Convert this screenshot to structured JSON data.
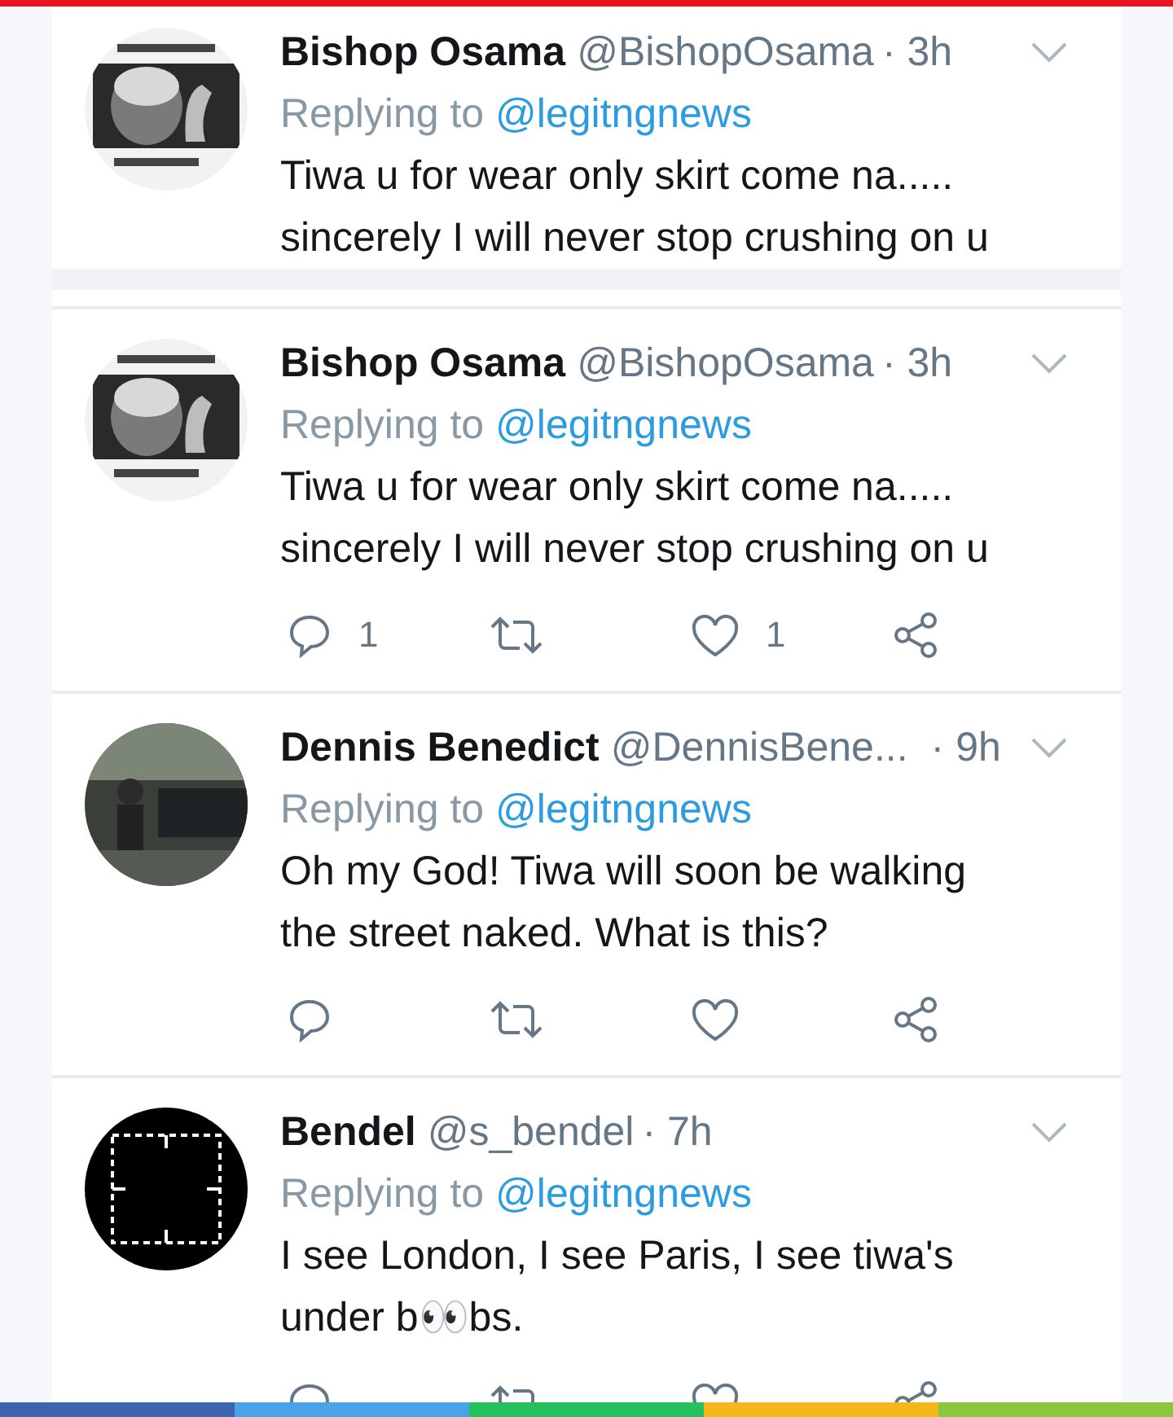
{
  "tweets": [
    {
      "name": "Bishop Osama",
      "handle": "@BishopOsama",
      "time": "· 3h",
      "replying_label": "Replying to",
      "replying_to": "@legitngnews",
      "text": "Tiwa u for wear only skirt come na..... sincerely I will never stop crushing on u"
    },
    {
      "name": "Bishop Osama",
      "handle": "@BishopOsama",
      "time": "· 3h",
      "replying_label": "Replying to",
      "replying_to": "@legitngnews",
      "text": "Tiwa u for wear only skirt come na..... sincerely I will never stop crushing on u",
      "actions": [
        {
          "kind": "reply",
          "count": "1"
        },
        {
          "kind": "retweet"
        },
        {
          "kind": "like",
          "count": "1"
        },
        {
          "kind": "share"
        }
      ]
    },
    {
      "name": "Dennis Benedict",
      "handle": "@DennisBene...",
      "time": "· 9h",
      "replying_label": "Replying to",
      "replying_to": "@legitngnews",
      "text": "Oh my God! Tiwa will soon be walking the street naked. What is this?",
      "actions": [
        {
          "kind": "reply"
        },
        {
          "kind": "retweet"
        },
        {
          "kind": "like"
        },
        {
          "kind": "share"
        }
      ]
    },
    {
      "name": "Bendel",
      "handle": "@s_bendel",
      "time": "· 7h",
      "replying_label": "Replying to",
      "replying_to": "@legitngnews",
      "text": "I see London, I see Paris, I see tiwa's under b👀bs.",
      "actions": [
        {
          "kind": "reply"
        },
        {
          "kind": "retweet"
        },
        {
          "kind": "like"
        },
        {
          "kind": "share"
        }
      ]
    }
  ]
}
